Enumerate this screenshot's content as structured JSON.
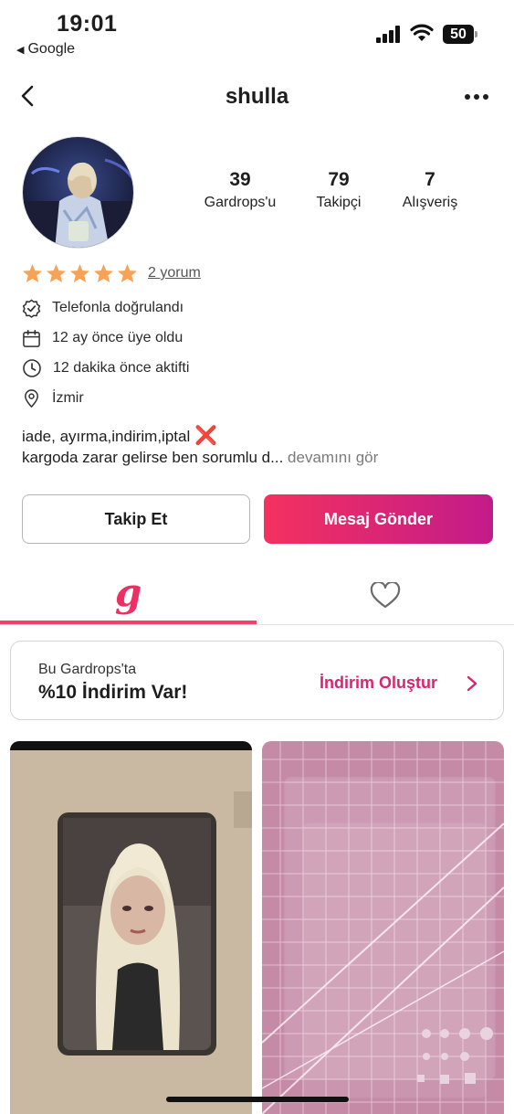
{
  "status": {
    "time": "19:01",
    "back_app": "Google",
    "battery": "50"
  },
  "header": {
    "title": "shulla"
  },
  "profile": {
    "stats": [
      {
        "value": "39",
        "label": "Gardrops'u"
      },
      {
        "value": "79",
        "label": "Takipçi"
      },
      {
        "value": "7",
        "label": "Alışveriş"
      }
    ],
    "rating_stars": 5,
    "reviews_label": "2 yorum",
    "info": {
      "verified": "Telefonla doğrulandı",
      "member_since": "12 ay önce üye oldu",
      "last_active": "12 dakika önce aktifti",
      "location": "İzmir"
    },
    "bio_line1": "iade, ayırma,indirim,iptal",
    "bio_emoji": "❌",
    "bio_line2": "kargoda zarar gelirse ben sorumlu d...",
    "bio_more": "devamını gör"
  },
  "actions": {
    "follow_label": "Takip Et",
    "message_label": "Mesaj Gönder"
  },
  "tabs": {
    "wardrobe_logo": "g"
  },
  "discount": {
    "small_text": "Bu Gardrops'ta",
    "big_text": "%10 İndirim Var!",
    "action_label": "İndirim Oluştur"
  },
  "colors": {
    "accent_pink": "#ef2f64",
    "star": "#f6a257",
    "message_gradient_start": "#f4315f",
    "message_gradient_end": "#c21b8a"
  }
}
